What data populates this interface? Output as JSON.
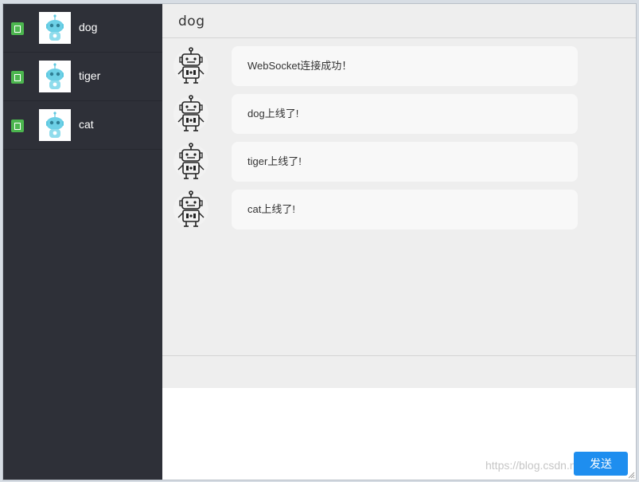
{
  "contacts": [
    {
      "name": "dog",
      "online": true
    },
    {
      "name": "tiger",
      "online": true
    },
    {
      "name": "cat",
      "online": true
    }
  ],
  "chat": {
    "title": "dog",
    "messages": [
      {
        "text": "WebSocket连接成功！"
      },
      {
        "text": "dog上线了!"
      },
      {
        "text": "tiger上线了!"
      },
      {
        "text": "cat上线了!"
      }
    ]
  },
  "composer": {
    "send_label": "发送",
    "value": ""
  },
  "watermark": "https://blog.csdn.net/N_Feng",
  "colors": {
    "sidebar_bg": "#2e3038",
    "online_badge": "#4cb64f",
    "chat_bg": "#eeeeee",
    "bubble_bg": "#f8f8f8",
    "send_button": "#1e8eef"
  },
  "icons": {
    "contact_avatar": "robot-face-icon",
    "message_avatar": "robot-icon",
    "online_indicator": "online-status-icon"
  }
}
